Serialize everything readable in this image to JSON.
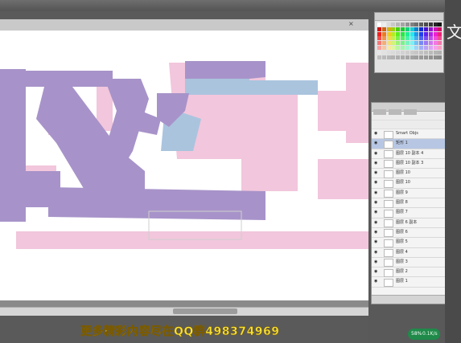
{
  "window": {
    "title": ""
  },
  "document_tab": {
    "title": "",
    "close_glyph": "×"
  },
  "panels": {
    "swatches": {
      "title": ""
    },
    "layers": {
      "rows": [
        {
          "name": "Smart Objs",
          "selected": false,
          "eye": "◉"
        },
        {
          "name": "矩形 1",
          "selected": true,
          "eye": "◉"
        },
        {
          "name": "图层 10 副本 4",
          "selected": false,
          "eye": "◉"
        },
        {
          "name": "图层 10 副本 3",
          "selected": false,
          "eye": "◉"
        },
        {
          "name": "图层 10",
          "selected": false,
          "eye": "◉"
        },
        {
          "name": "图层 10",
          "selected": false,
          "eye": "◉"
        },
        {
          "name": "图层 9",
          "selected": false,
          "eye": "◉"
        },
        {
          "name": "图层 8",
          "selected": false,
          "eye": "◉"
        },
        {
          "name": "图层 7",
          "selected": false,
          "eye": "◉"
        },
        {
          "name": "图层 6 副本",
          "selected": false,
          "eye": "◉"
        },
        {
          "name": "图层 6",
          "selected": false,
          "eye": "◉"
        },
        {
          "name": "图层 5",
          "selected": false,
          "eye": "◉"
        },
        {
          "name": "图层 4",
          "selected": false,
          "eye": "◉"
        },
        {
          "name": "图层 3",
          "selected": false,
          "eye": "◉"
        },
        {
          "name": "图层 2",
          "selected": false,
          "eye": "◉"
        },
        {
          "name": "图层 1",
          "selected": false,
          "eye": "◉"
        }
      ]
    }
  },
  "right_strip": {
    "glyph": "文"
  },
  "banner": {
    "text": "更多精彩内容尽在QQ群498374969"
  },
  "tray": {
    "net": "58%",
    "time": "0.1K/s"
  },
  "colors": {
    "purple": "#a793c9",
    "pink": "#f2c6dc",
    "blue": "#aac4de",
    "banner": "#f7e23a"
  }
}
